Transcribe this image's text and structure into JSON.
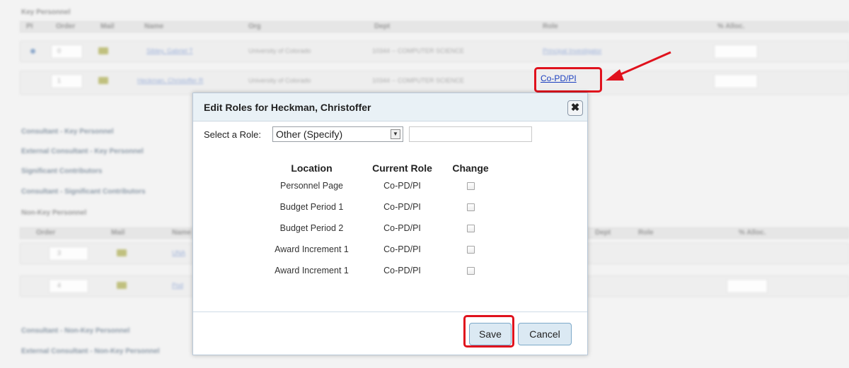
{
  "background": {
    "sections": {
      "key_personnel": "Key Personnel",
      "consultant_key": "Consultant - Key Personnel",
      "external_consultant_key": "External Consultant - Key Personnel",
      "significant_contributors": "Significant Contributors",
      "consultant_significant": "Consultant - Significant Contributors",
      "non_key_personnel": "Non-Key Personnel",
      "consultant_non_key": "Consultant - Non-Key Personnel",
      "external_consultant_non_key": "External Consultant - Non-Key Personnel"
    },
    "key_columns": [
      "PI",
      "Order",
      "Mail",
      "Name",
      "Org",
      "Dept",
      "Role",
      "% Alloc."
    ],
    "key_rows": [
      {
        "order": "0",
        "name": "Sibley, Gabriel T",
        "org": "University of Colorado",
        "dept": "10344 -- COMPUTER SCIENCE",
        "role": "Principal Investigator"
      },
      {
        "order": "1",
        "name": "Heckman, Christoffer R",
        "org": "University of Colorado",
        "dept": "10344 -- COMPUTER SCIENCE",
        "role": "Co-PD/PI"
      }
    ],
    "nonkey_columns": [
      "Order",
      "Mail",
      "Name",
      "Dept",
      "Role",
      "% Alloc."
    ],
    "nonkey_rows": [
      {
        "order": "3",
        "name": "UNA"
      },
      {
        "order": "4",
        "name": "Pod"
      }
    ]
  },
  "dialog": {
    "title": "Edit Roles for Heckman, Christoffer",
    "close_glyph": "✖",
    "select_label": "Select a Role:",
    "selected_role": "Other (Specify)",
    "other_role_value": "",
    "columns": {
      "location": "Location",
      "current_role": "Current Role",
      "change": "Change"
    },
    "rows": [
      {
        "location": "Personnel Page",
        "current_role": "Co-PD/PI",
        "change": false
      },
      {
        "location": "Budget Period 1",
        "current_role": "Co-PD/PI",
        "change": false
      },
      {
        "location": "Budget Period 2",
        "current_role": "Co-PD/PI",
        "change": false
      },
      {
        "location": "Award Increment 1",
        "current_role": "Co-PD/PI",
        "change": false
      },
      {
        "location": "Award Increment 1",
        "current_role": "Co-PD/PI",
        "change": false
      }
    ],
    "save_label": "Save",
    "cancel_label": "Cancel"
  },
  "highlighted_role_link": "Co-PD/PI",
  "annotation_color": "#e0121d",
  "link_color": "#1a3fbf"
}
